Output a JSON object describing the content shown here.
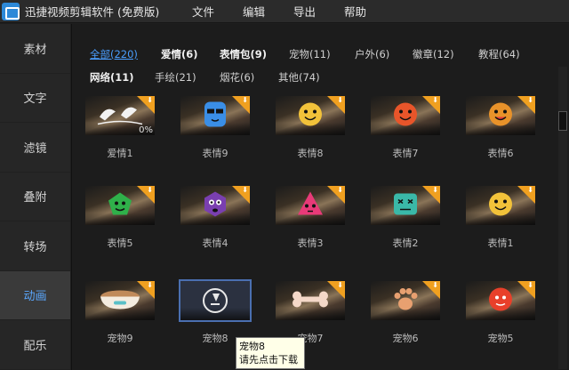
{
  "app": {
    "title": "迅捷视频剪辑软件 (免费版)"
  },
  "menu": [
    "文件",
    "编辑",
    "导出",
    "帮助"
  ],
  "sidebar": {
    "items": [
      {
        "label": "素材",
        "active": false
      },
      {
        "label": "文字",
        "active": false
      },
      {
        "label": "滤镜",
        "active": false
      },
      {
        "label": "叠附",
        "active": false
      },
      {
        "label": "转场",
        "active": false
      },
      {
        "label": "动画",
        "active": true
      },
      {
        "label": "配乐",
        "active": false
      }
    ]
  },
  "categories": [
    {
      "label": "全部(220)",
      "active": true
    },
    {
      "label": "爱情(6)"
    },
    {
      "label": "表情包(9)"
    },
    {
      "label": "宠物(11)"
    },
    {
      "label": "户外(6)"
    },
    {
      "label": "徽章(12)"
    },
    {
      "label": "教程(64)"
    },
    {
      "label": "网络(11)"
    },
    {
      "label": "手绘(21)"
    },
    {
      "label": "烟花(6)"
    },
    {
      "label": "其他(74)"
    }
  ],
  "items": [
    {
      "label": "爱情1",
      "sticker": "doves-sticker",
      "progress": "0%"
    },
    {
      "label": "表情9",
      "sticker": "sunglasses-face-sticker",
      "color": "#3a8ee6"
    },
    {
      "label": "表情8",
      "sticker": "love-face-sticker",
      "color": "#f2c23a"
    },
    {
      "label": "表情7",
      "sticker": "angry-face-sticker",
      "color": "#e8552a"
    },
    {
      "label": "表情6",
      "sticker": "tongue-face-sticker",
      "color": "#e8922a"
    },
    {
      "label": "表情5",
      "sticker": "green-face-sticker",
      "color": "#2fb04a"
    },
    {
      "label": "表情4",
      "sticker": "purple-face-sticker",
      "color": "#7a3fb0"
    },
    {
      "label": "表情3",
      "sticker": "pink-face-sticker",
      "color": "#e83a78"
    },
    {
      "label": "表情2",
      "sticker": "teal-face-sticker",
      "color": "#3ab8a8"
    },
    {
      "label": "表情1",
      "sticker": "smile-face-sticker",
      "color": "#f2c23a"
    },
    {
      "label": "宠物9",
      "sticker": "bowl-sticker",
      "color": "#f4ece0"
    },
    {
      "label": "宠物8",
      "sticker": "download-icon",
      "selected": true
    },
    {
      "label": "宠物7",
      "sticker": "bone-sticker",
      "color": "#f4d8c8"
    },
    {
      "label": "宠物6",
      "sticker": "paw-sticker",
      "color": "#e8a070"
    },
    {
      "label": "宠物5",
      "sticker": "red-ball-sticker",
      "color": "#e8402a"
    }
  ],
  "tooltip": {
    "title": "宠物8",
    "hint": "请先点击下载"
  }
}
